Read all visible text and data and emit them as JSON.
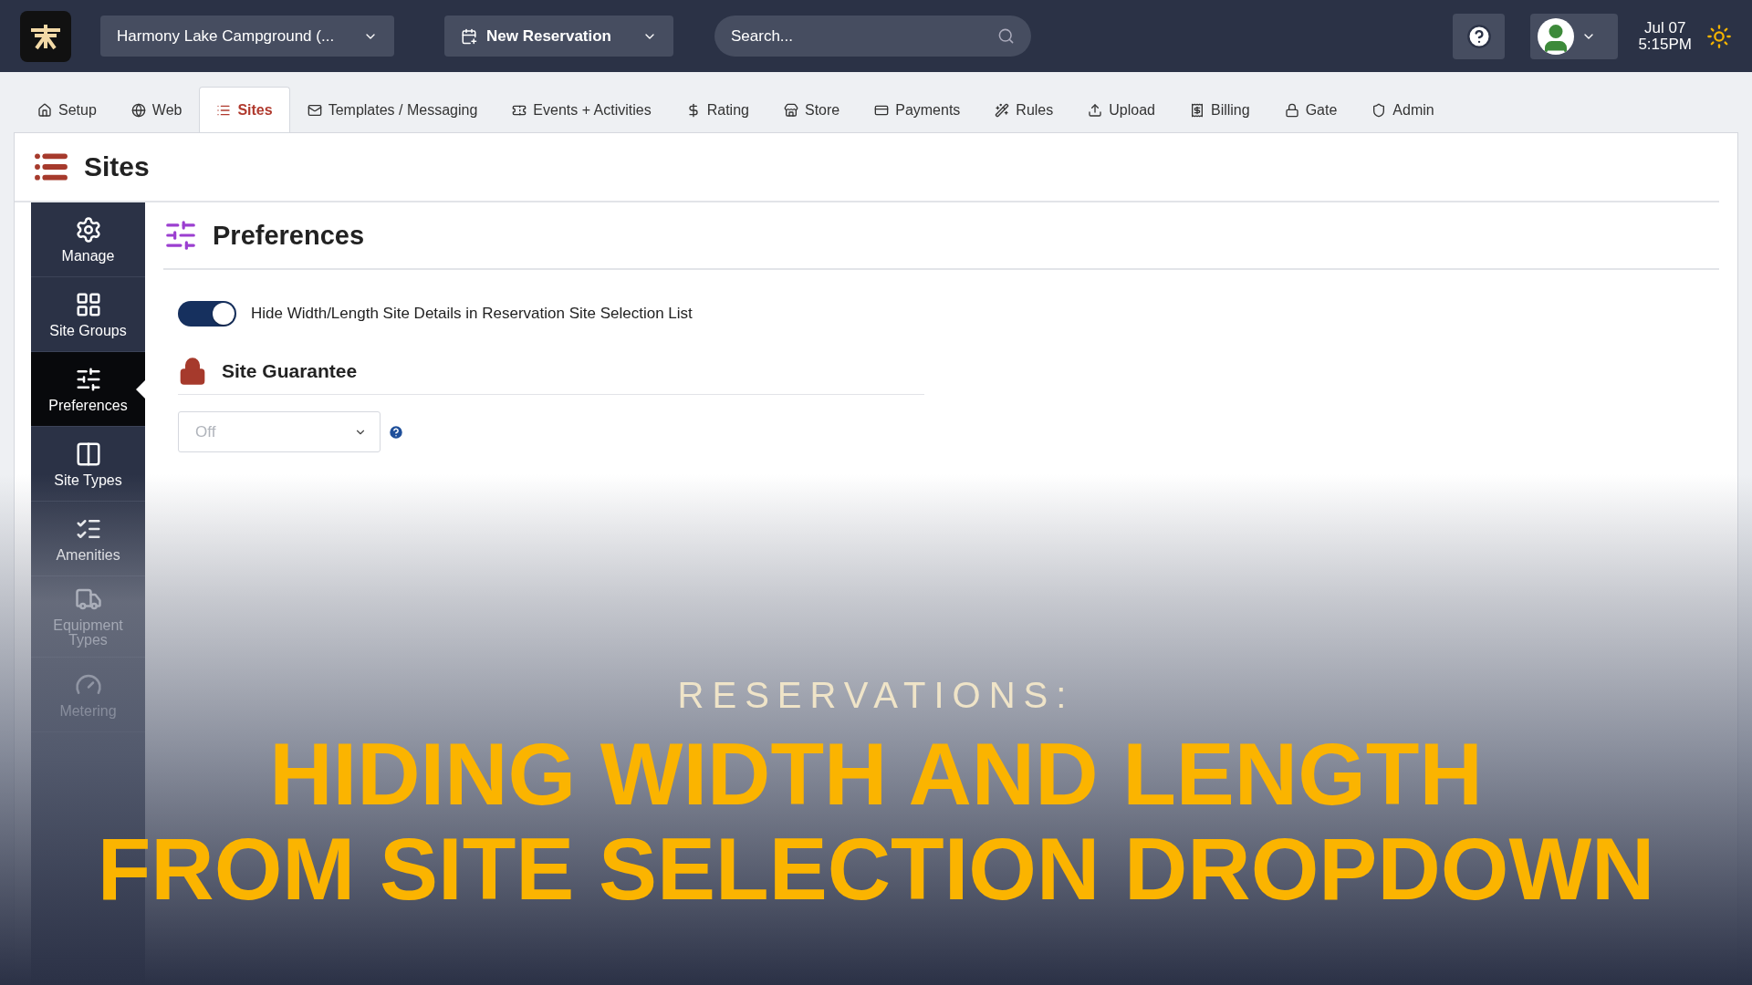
{
  "top_bar": {
    "campground": "Harmony Lake Campground (...",
    "new_reservation": "New Reservation",
    "search": {
      "placeholder": "Search..."
    },
    "date": "Jul 07",
    "time": "5:15PM"
  },
  "tabs": [
    {
      "label": "Setup",
      "selected": false
    },
    {
      "label": "Web",
      "selected": false
    },
    {
      "label": "Sites",
      "selected": true
    },
    {
      "label": "Templates / Messaging",
      "selected": false
    },
    {
      "label": "Events + Activities",
      "selected": false
    },
    {
      "label": "Rating",
      "selected": false
    },
    {
      "label": "Store",
      "selected": false
    },
    {
      "label": "Payments",
      "selected": false
    },
    {
      "label": "Rules",
      "selected": false
    },
    {
      "label": "Upload",
      "selected": false
    },
    {
      "label": "Billing",
      "selected": false
    },
    {
      "label": "Gate",
      "selected": false
    },
    {
      "label": "Admin",
      "selected": false
    }
  ],
  "page_title": "Sites",
  "sidebar": {
    "items": [
      {
        "label": "Manage",
        "selected": false,
        "disabled": false
      },
      {
        "label": "Site Groups",
        "selected": false,
        "disabled": false
      },
      {
        "label": "Preferences",
        "selected": true,
        "disabled": false
      },
      {
        "label": "Site Types",
        "selected": false,
        "disabled": false
      },
      {
        "label": "Amenities",
        "selected": false,
        "disabled": false
      },
      {
        "label": "Equipment Types",
        "selected": false,
        "disabled": true
      },
      {
        "label": "Metering",
        "selected": false,
        "disabled": true
      }
    ]
  },
  "panel": {
    "title": "Preferences",
    "toggle": {
      "label": "Hide Width/Length Site Details in Reservation Site Selection List",
      "on": true
    },
    "section": "Site Guarantee",
    "select": {
      "value": "Off",
      "disabled": true
    }
  },
  "overlay": {
    "kicker": "RESERVATIONS:",
    "headline": [
      "HIDING WIDTH AND LENGTH",
      "FROM SITE SELECTION DROPDOWN"
    ]
  }
}
